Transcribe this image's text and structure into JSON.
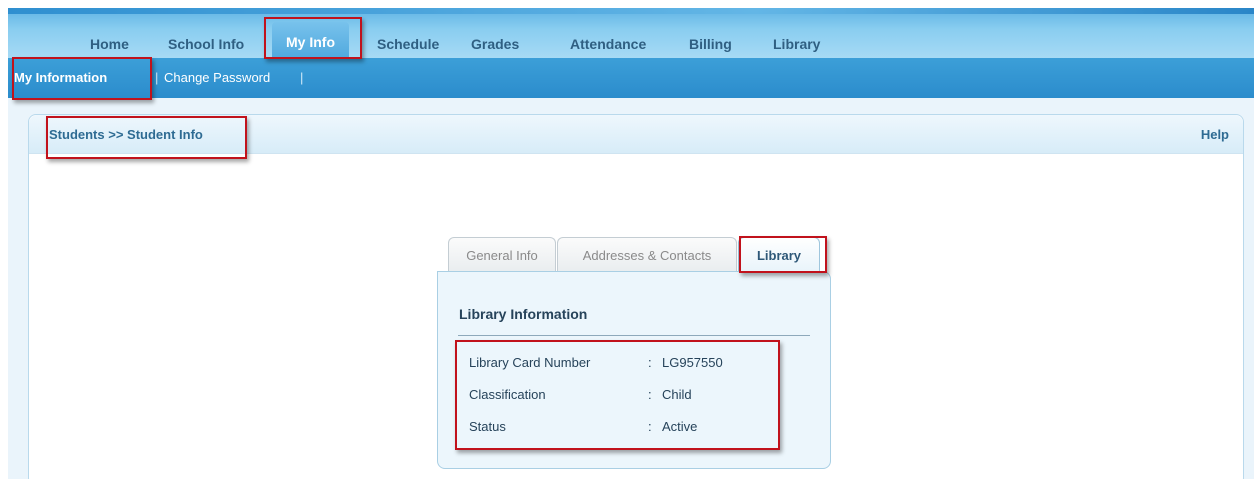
{
  "top_nav": {
    "items": [
      "Home",
      "School Info",
      "My Info",
      "Schedule",
      "Grades",
      "Attendance",
      "Billing",
      "Library"
    ],
    "active": "My Info"
  },
  "sub_nav": {
    "items": [
      "My Information",
      "Change Password"
    ],
    "separator": "|"
  },
  "panel": {
    "breadcrumb": "Students >> Student Info",
    "help": "Help"
  },
  "tabs": [
    "General Info",
    "Addresses & Contacts",
    "Library"
  ],
  "active_tab": "Library",
  "library": {
    "title": "Library Information",
    "rows": [
      {
        "label": "Library Card Number",
        "colon": ":",
        "value": "LG957550"
      },
      {
        "label": "Classification",
        "colon": ":",
        "value": "Child"
      },
      {
        "label": "Status",
        "colon": ":",
        "value": "Active"
      }
    ]
  },
  "colors": {
    "highlight": "#c1121c",
    "nav_blue": "#2b8ccc"
  }
}
